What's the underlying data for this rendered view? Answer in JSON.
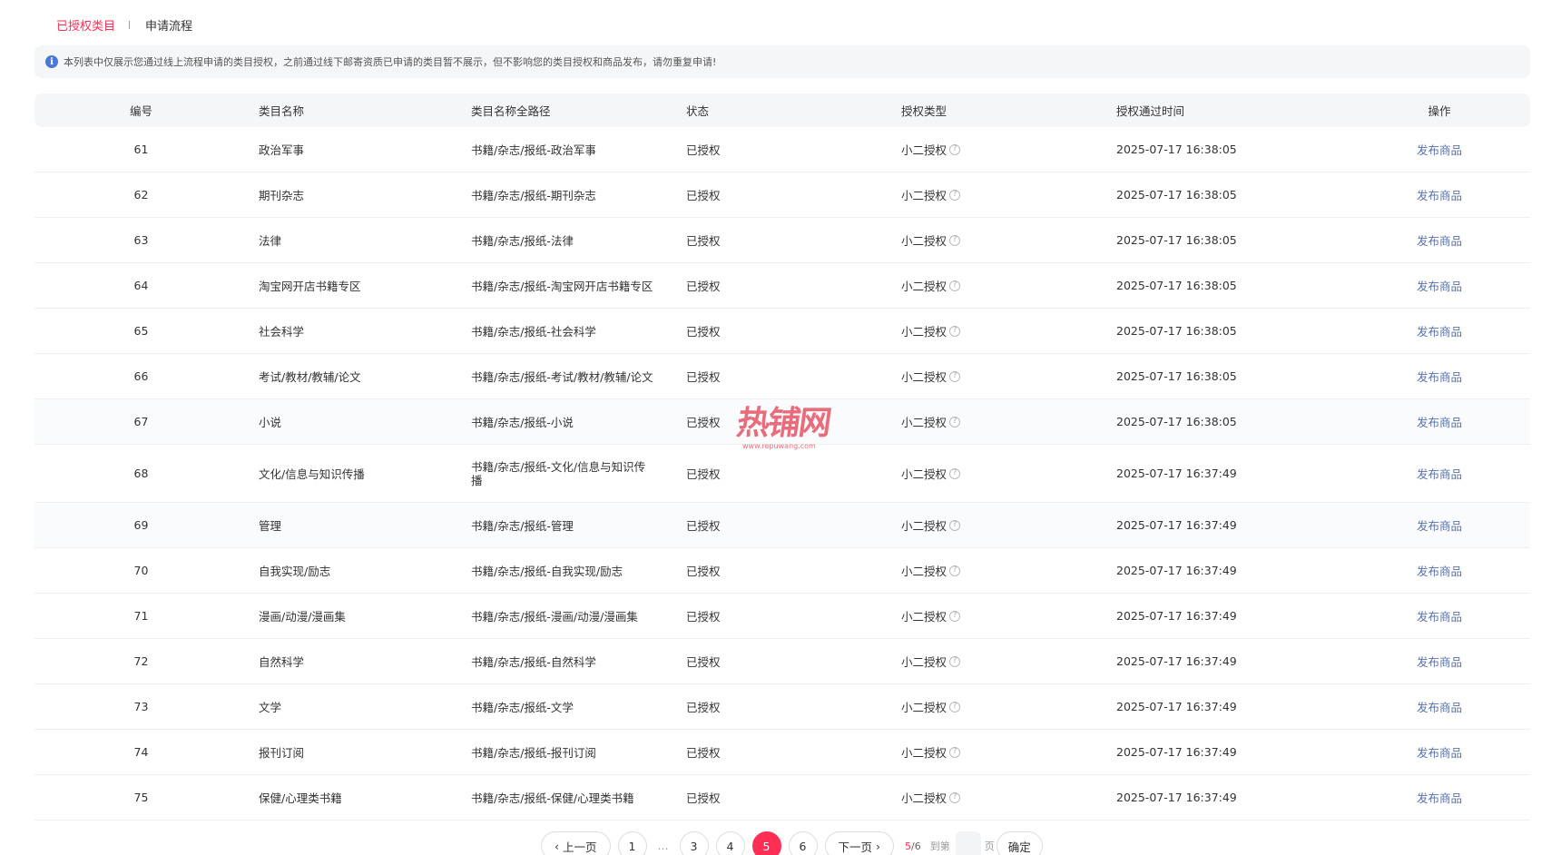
{
  "tabs": [
    {
      "label": "已授权类目",
      "active": true
    },
    {
      "label": "申请流程",
      "active": false
    }
  ],
  "notice": {
    "icon": "info-icon",
    "text": "本列表中仅展示您通过线上流程申请的类目授权，之前通过线下邮寄资质已申请的类目暂不展示，但不影响您的类目授权和商品发布，请勿重复申请!"
  },
  "table": {
    "headers": [
      "编号",
      "类目名称",
      "类目名称全路径",
      "状态",
      "授权类型",
      "授权通过时间",
      "操作"
    ],
    "rows": [
      {
        "id": "61",
        "name": "政治军事",
        "path": "书籍/杂志/报纸-政治军事",
        "status": "已授权",
        "type": "小二授权",
        "time": "2025-07-17 16:38:05",
        "action": "发布商品"
      },
      {
        "id": "62",
        "name": "期刊杂志",
        "path": "书籍/杂志/报纸-期刊杂志",
        "status": "已授权",
        "type": "小二授权",
        "time": "2025-07-17 16:38:05",
        "action": "发布商品"
      },
      {
        "id": "63",
        "name": "法律",
        "path": "书籍/杂志/报纸-法律",
        "status": "已授权",
        "type": "小二授权",
        "time": "2025-07-17 16:38:05",
        "action": "发布商品"
      },
      {
        "id": "64",
        "name": "淘宝网开店书籍专区",
        "path": "书籍/杂志/报纸-淘宝网开店书籍专区",
        "status": "已授权",
        "type": "小二授权",
        "time": "2025-07-17 16:38:05",
        "action": "发布商品"
      },
      {
        "id": "65",
        "name": "社会科学",
        "path": "书籍/杂志/报纸-社会科学",
        "status": "已授权",
        "type": "小二授权",
        "time": "2025-07-17 16:38:05",
        "action": "发布商品"
      },
      {
        "id": "66",
        "name": "考试/教材/教辅/论文",
        "path": "书籍/杂志/报纸-考试/教材/教辅/论文",
        "status": "已授权",
        "type": "小二授权",
        "time": "2025-07-17 16:38:05",
        "action": "发布商品"
      },
      {
        "id": "67",
        "name": "小说",
        "path": "书籍/杂志/报纸-小说",
        "status": "已授权",
        "type": "小二授权",
        "time": "2025-07-17 16:38:05",
        "action": "发布商品"
      },
      {
        "id": "68",
        "name": "文化/信息与知识传播",
        "path": "书籍/杂志/报纸-文化/信息与知识传播",
        "status": "已授权",
        "type": "小二授权",
        "time": "2025-07-17 16:37:49",
        "action": "发布商品"
      },
      {
        "id": "69",
        "name": "管理",
        "path": "书籍/杂志/报纸-管理",
        "status": "已授权",
        "type": "小二授权",
        "time": "2025-07-17 16:37:49",
        "action": "发布商品"
      },
      {
        "id": "70",
        "name": "自我实现/励志",
        "path": "书籍/杂志/报纸-自我实现/励志",
        "status": "已授权",
        "type": "小二授权",
        "time": "2025-07-17 16:37:49",
        "action": "发布商品"
      },
      {
        "id": "71",
        "name": "漫画/动漫/漫画集",
        "path": "书籍/杂志/报纸-漫画/动漫/漫画集",
        "status": "已授权",
        "type": "小二授权",
        "time": "2025-07-17 16:37:49",
        "action": "发布商品"
      },
      {
        "id": "72",
        "name": "自然科学",
        "path": "书籍/杂志/报纸-自然科学",
        "status": "已授权",
        "type": "小二授权",
        "time": "2025-07-17 16:37:49",
        "action": "发布商品"
      },
      {
        "id": "73",
        "name": "文学",
        "path": "书籍/杂志/报纸-文学",
        "status": "已授权",
        "type": "小二授权",
        "time": "2025-07-17 16:37:49",
        "action": "发布商品"
      },
      {
        "id": "74",
        "name": "报刊订阅",
        "path": "书籍/杂志/报纸-报刊订阅",
        "status": "已授权",
        "type": "小二授权",
        "time": "2025-07-17 16:37:49",
        "action": "发布商品"
      },
      {
        "id": "75",
        "name": "保健/心理类书籍",
        "path": "书籍/杂志/报纸-保健/心理类书籍",
        "status": "已授权",
        "type": "小二授权",
        "time": "2025-07-17 16:37:49",
        "action": "发布商品"
      }
    ]
  },
  "watermark": {
    "main": "热铺网",
    "sub": "www.repuwang.com"
  },
  "pagination": {
    "prev_label": "上一页",
    "next_label": "下一页",
    "pages": [
      "1",
      "…",
      "3",
      "4",
      "5",
      "6"
    ],
    "current_page": "5",
    "page_count_current": "5",
    "page_count_total": "/6",
    "goto_label": "到第",
    "page_suffix": "页",
    "input_value": "",
    "confirm_label": "确定"
  },
  "colors": {
    "accent": "#ff2e54",
    "link": "#5a72a8",
    "info": "#4a78d6"
  }
}
